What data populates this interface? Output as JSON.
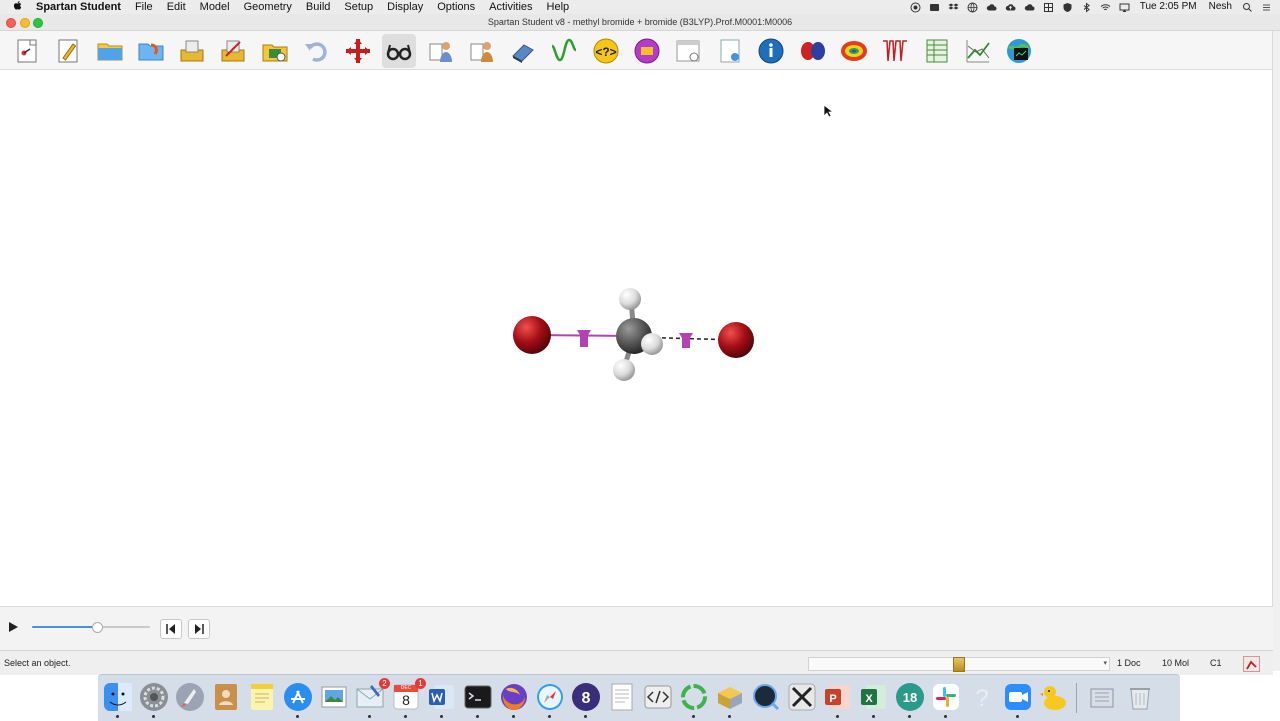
{
  "menubar": {
    "app_name": "Spartan Student",
    "items": [
      "File",
      "Edit",
      "Model",
      "Geometry",
      "Build",
      "Setup",
      "Display",
      "Options",
      "Activities",
      "Help"
    ],
    "clock": "Tue 2:05 PM",
    "user": "Nesh",
    "status_icons": [
      "record-icon",
      "screen-icon",
      "dropbox-icon",
      "globe-icon",
      "cloud-icon",
      "cloud-upload-icon",
      "cloud-sync-icon",
      "grid-icon",
      "shield-s-icon",
      "bluetooth-icon",
      "wifi-icon",
      "cast-icon",
      "search-icon",
      "list-icon"
    ]
  },
  "window": {
    "title": "Spartan Student v8 - methyl bromide + bromide (B3LYP).Prof.M0001:M0006"
  },
  "toolbar": {
    "tools": [
      "new-build-icon",
      "new-sketch-icon",
      "open-icon",
      "open-recent-icon",
      "save-icon",
      "save-as-icon",
      "insert-icon",
      "undo-icon",
      "delete-icon",
      "view-icon",
      "add-fragment-icon",
      "edit-build-icon",
      "eraser-icon",
      "plots-icon",
      "help-query-icon",
      "calculations-icon",
      "output-icon",
      "properties-icon",
      "info-icon",
      "orbitals-icon",
      "surfaces-icon",
      "spectra-icon",
      "spreadsheet-icon",
      "plot-graph-icon",
      "databases-icon"
    ],
    "active_tool": "view-icon"
  },
  "playback": {
    "progress": 0.55
  },
  "statusbar": {
    "message": "Select an object.",
    "molecule_position": 0.5,
    "doc_count": "1 Doc",
    "mol_count": "10 Mol",
    "symmetry": "C1"
  },
  "dock": {
    "apps": [
      "finder-icon",
      "system-preferences-icon",
      "launchpad-icon",
      "contacts-icon",
      "notes-icon",
      "app-store-icon",
      "preview-icon",
      "mail-icon",
      "calendar-icon",
      "word-icon",
      "terminal-icon",
      "firefox-icon",
      "safari-icon",
      "spartan-icon",
      "textedit-icon",
      "script-editor-icon",
      "sync-icon",
      "archive-utility-icon",
      "quicktime-icon",
      "x11-icon",
      "powerpoint-icon",
      "excel-icon",
      "spartan18-icon",
      "slack-icon",
      "help-icon",
      "zoom-icon",
      "cyberduck-icon",
      "downloads-icon",
      "trash-icon"
    ],
    "badges": {
      "mail-icon": "2",
      "calendar-icon": "1"
    },
    "calendar_day": "8",
    "calendar_month": "DEC"
  },
  "colors": {
    "bromine": "#a50f15",
    "carbon": "#555555",
    "hydrogen": "#e8e8e8",
    "bond_marker": "#b342b3"
  }
}
